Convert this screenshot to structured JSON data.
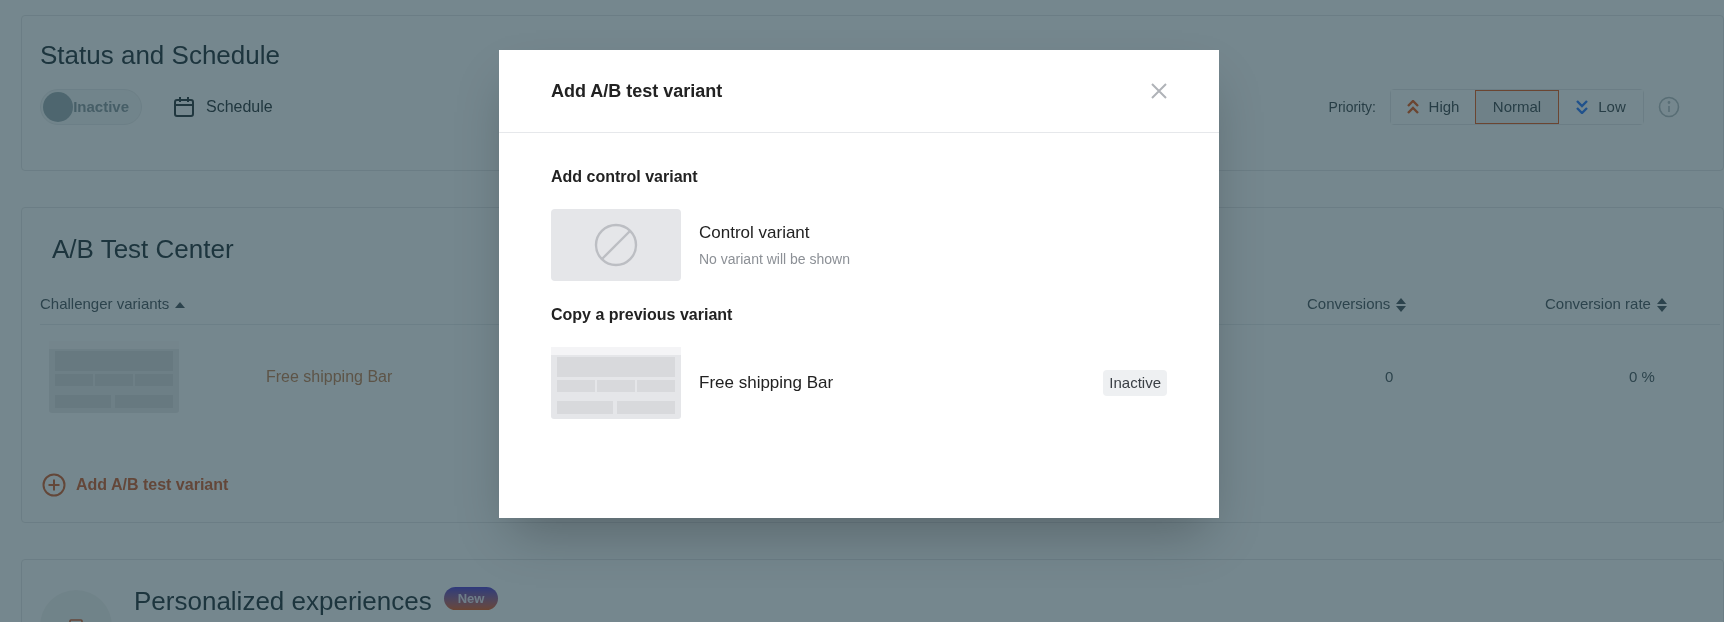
{
  "status_card": {
    "title": "Status and Schedule",
    "toggle": {
      "label": "Inactive",
      "on": false
    },
    "schedule": "Schedule",
    "priority": {
      "label": "Priority:",
      "options": [
        {
          "label": "High",
          "kind": "high",
          "selected": false
        },
        {
          "label": "Normal",
          "kind": "normal",
          "selected": true
        },
        {
          "label": "Low",
          "kind": "low",
          "selected": false
        }
      ]
    }
  },
  "ab_card": {
    "title": "A/B Test Center",
    "columns": [
      {
        "label": "Challenger variants",
        "sorted": true
      },
      {
        "label": "Conversions",
        "sorted": false
      },
      {
        "label": "Conversion rate",
        "sorted": false
      }
    ],
    "rows": [
      {
        "name": "Free shipping Bar",
        "conversions": "0",
        "conversion_rate": "0 %"
      }
    ],
    "add_button": "Add A/B test variant"
  },
  "personalized_card": {
    "title": "Personalized experiences",
    "badge": "New"
  },
  "modal": {
    "title": "Add A/B test variant",
    "sections": [
      {
        "heading": "Add control variant",
        "items": [
          {
            "kind": "control",
            "title": "Control variant",
            "subtitle": "No variant will be shown"
          }
        ]
      },
      {
        "heading": "Copy a previous variant",
        "items": [
          {
            "kind": "copy",
            "title": "Free shipping Bar",
            "status": "Inactive"
          }
        ]
      }
    ]
  }
}
